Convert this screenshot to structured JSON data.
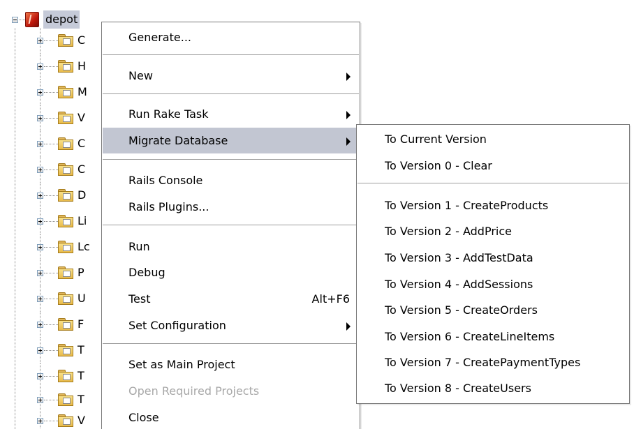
{
  "tree": {
    "root_label": "depot",
    "children": [
      {
        "label": "C"
      },
      {
        "label": "H"
      },
      {
        "label": "M"
      },
      {
        "label": "V"
      },
      {
        "label": "C"
      },
      {
        "label": "C"
      },
      {
        "label": "D"
      },
      {
        "label": "Li"
      },
      {
        "label": "Lc"
      },
      {
        "label": "P"
      },
      {
        "label": "U"
      },
      {
        "label": "F"
      },
      {
        "label": "T"
      },
      {
        "label": "T"
      },
      {
        "label": "T"
      },
      {
        "label": "V"
      }
    ]
  },
  "context_menu": {
    "items": [
      {
        "label": "Generate..."
      },
      {
        "label": "New",
        "has_submenu": true
      },
      {
        "label": "Run Rake Task",
        "has_submenu": true
      },
      {
        "label": "Migrate Database",
        "has_submenu": true,
        "highlighted": true
      },
      {
        "label": "Rails Console"
      },
      {
        "label": "Rails Plugins..."
      },
      {
        "label": "Run"
      },
      {
        "label": "Debug"
      },
      {
        "label": "Test",
        "shortcut": "Alt+F6"
      },
      {
        "label": "Set Configuration",
        "has_submenu": true
      },
      {
        "label": "Set as Main Project"
      },
      {
        "label": "Open Required Projects",
        "disabled": true
      },
      {
        "label": "Close"
      }
    ]
  },
  "migrate_submenu": {
    "items": [
      {
        "label": "To Current Version"
      },
      {
        "label": "To Version 0 - Clear"
      },
      {
        "label": "To Version 1 - CreateProducts"
      },
      {
        "label": "To Version 2 - AddPrice"
      },
      {
        "label": "To Version 3 - AddTestData"
      },
      {
        "label": "To Version 4 - AddSessions"
      },
      {
        "label": "To Version 5 - CreateOrders"
      },
      {
        "label": "To Version 6 - CreateLineItems"
      },
      {
        "label": "To Version 7 - CreatePaymentTypes"
      },
      {
        "label": "To Version 8 - CreateUsers"
      }
    ]
  },
  "colors": {
    "highlight": "#c2c6d2",
    "selection": "#c5cad8",
    "disabled_text": "#a8a8a8",
    "separator": "#9d9d9d"
  }
}
